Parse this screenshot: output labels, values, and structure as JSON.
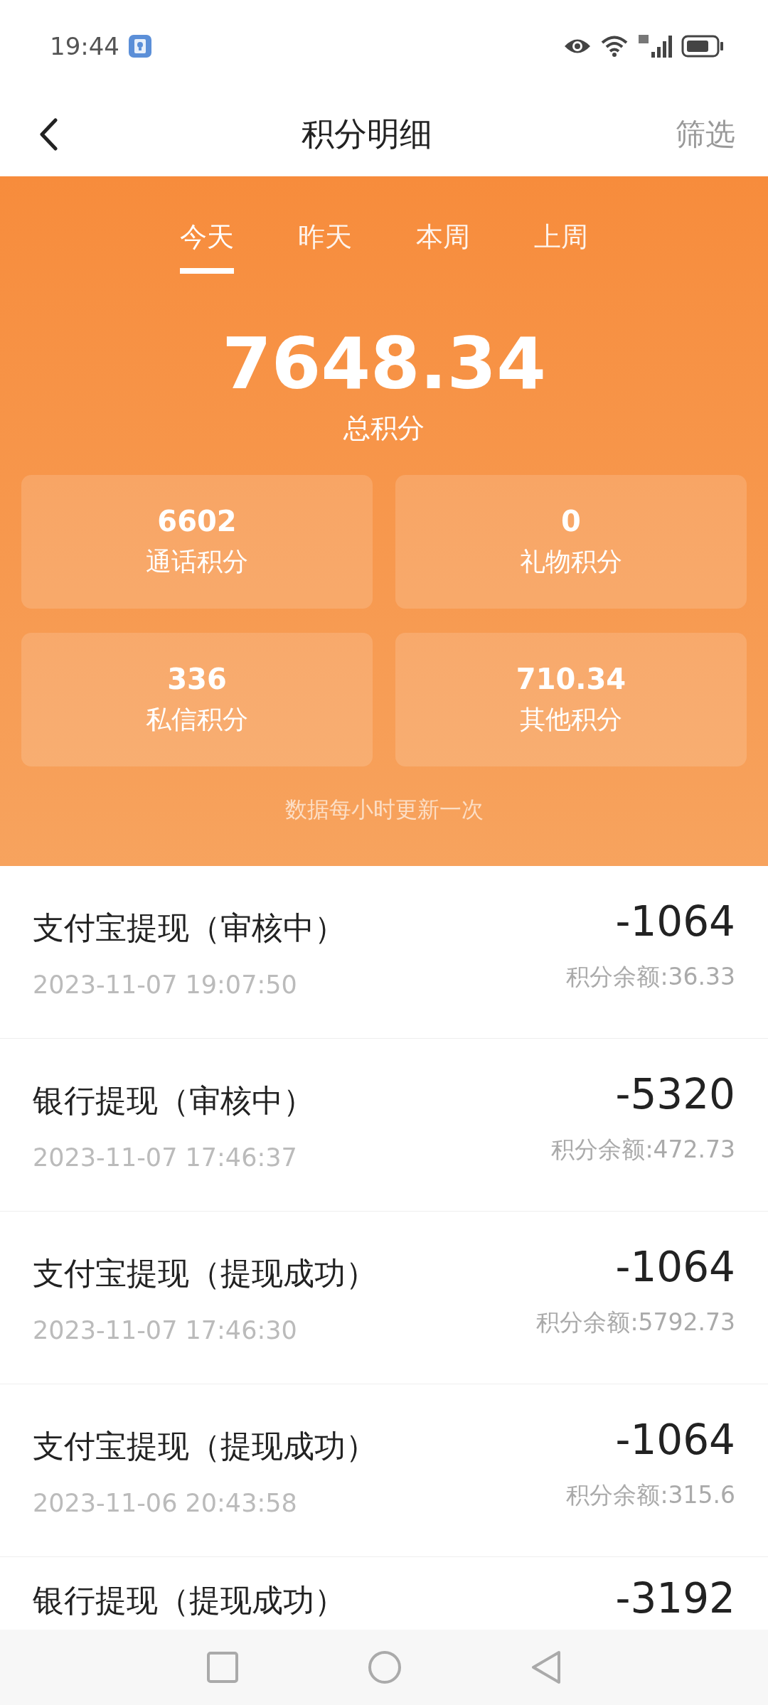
{
  "status_bar": {
    "time": "19:44"
  },
  "header": {
    "title": "积分明细",
    "action": "筛选"
  },
  "period_tabs": [
    {
      "label": "今天",
      "selected": true
    },
    {
      "label": "昨天",
      "selected": false
    },
    {
      "label": "本周",
      "selected": false
    },
    {
      "label": "上周",
      "selected": false
    }
  ],
  "total": {
    "value": "7648.34",
    "label": "总积分"
  },
  "stat_cards": [
    {
      "value": "6602",
      "label": "通话积分"
    },
    {
      "value": "0",
      "label": "礼物积分"
    },
    {
      "value": "336",
      "label": "私信积分"
    },
    {
      "value": "710.34",
      "label": "其他积分"
    }
  ],
  "update_note": "数据每小时更新一次",
  "records": [
    {
      "title": "支付宝提现（审核中）",
      "time": "2023-11-07 19:07:50",
      "amount": "-1064",
      "balance": "积分余额:36.33"
    },
    {
      "title": "银行提现（审核中）",
      "time": "2023-11-07 17:46:37",
      "amount": "-5320",
      "balance": "积分余额:472.73"
    },
    {
      "title": "支付宝提现（提现成功）",
      "time": "2023-11-07 17:46:30",
      "amount": "-1064",
      "balance": "积分余额:5792.73"
    },
    {
      "title": "支付宝提现（提现成功）",
      "time": "2023-11-06 20:43:58",
      "amount": "-1064",
      "balance": "积分余额:315.6"
    },
    {
      "title": "银行提现（提现成功）",
      "amount": "-3192"
    }
  ]
}
